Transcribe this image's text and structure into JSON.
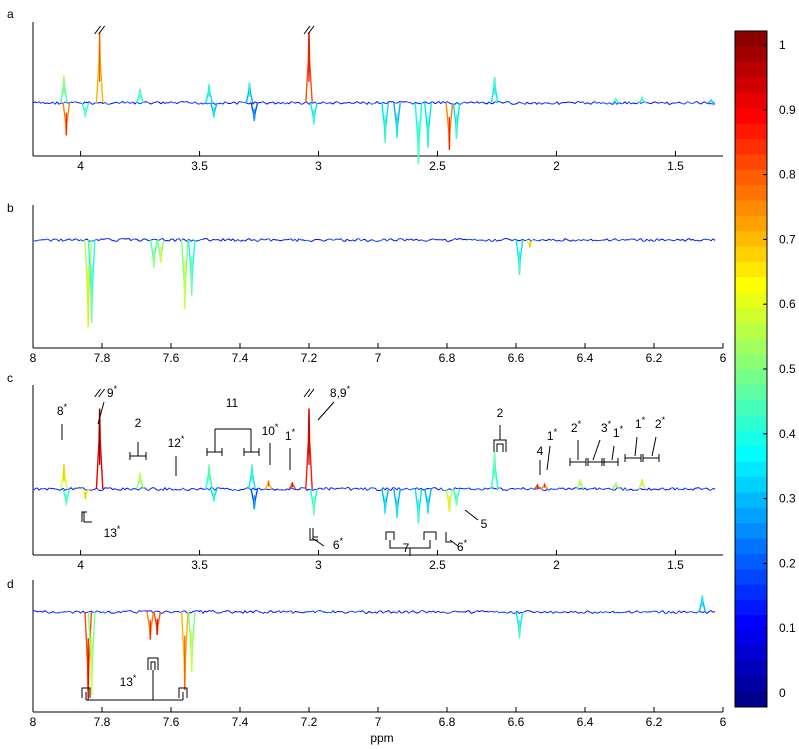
{
  "chart_data": [
    {
      "panel": "a",
      "type": "line",
      "x_axis_reversed": true,
      "xlim": [
        4.2,
        1.3
      ],
      "xticks": [
        "4",
        "3.5",
        "3",
        "2.5",
        "2",
        "1.5"
      ],
      "xtick_values": [
        4,
        3.5,
        3,
        2.5,
        2,
        1.5
      ],
      "ylim": [
        -1,
        1
      ],
      "peaks": [
        {
          "x": 4.07,
          "y": 0.38,
          "c": 0.45
        },
        {
          "x": 4.06,
          "y": -0.45,
          "c": 0.75
        },
        {
          "x": 3.98,
          "y": -0.2,
          "c": 0.4
        },
        {
          "x": 3.92,
          "y": 0.98,
          "c": 0.7
        },
        {
          "x": 3.75,
          "y": 0.2,
          "c": 0.4
        },
        {
          "x": 3.46,
          "y": 0.26,
          "c": 0.35
        },
        {
          "x": 3.44,
          "y": -0.2,
          "c": 0.3
        },
        {
          "x": 3.29,
          "y": 0.28,
          "c": 0.3
        },
        {
          "x": 3.27,
          "y": -0.25,
          "c": 0.2
        },
        {
          "x": 3.04,
          "y": 0.98,
          "c": 0.8
        },
        {
          "x": 3.02,
          "y": -0.3,
          "c": 0.35
        },
        {
          "x": 2.72,
          "y": -0.55,
          "c": 0.35
        },
        {
          "x": 2.67,
          "y": -0.48,
          "c": 0.3
        },
        {
          "x": 2.58,
          "y": -0.85,
          "c": 0.38
        },
        {
          "x": 2.54,
          "y": -0.62,
          "c": 0.35
        },
        {
          "x": 2.45,
          "y": -0.65,
          "c": 0.75
        },
        {
          "x": 2.42,
          "y": -0.5,
          "c": 0.35
        },
        {
          "x": 2.26,
          "y": 0.36,
          "c": 0.35
        },
        {
          "x": 1.75,
          "y": 0.06,
          "c": 0.4
        },
        {
          "x": 1.64,
          "y": 0.08,
          "c": 0.4
        },
        {
          "x": 1.35,
          "y": 0.04,
          "c": 0.3
        }
      ],
      "break_marks": [
        3.92,
        3.04
      ]
    },
    {
      "panel": "b",
      "type": "line",
      "x_axis_reversed": true,
      "xlim": [
        8,
        6
      ],
      "xticks": [
        "8",
        "7.8",
        "7.6",
        "7.4",
        "7.2",
        "7",
        "6.8",
        "6.6",
        "6.4",
        "6.2",
        "6"
      ],
      "xtick_values": [
        8,
        7.8,
        7.6,
        7.4,
        7.2,
        7,
        6.8,
        6.6,
        6.4,
        6.2,
        6
      ],
      "ylim": [
        -1,
        1
      ],
      "peaks": [
        {
          "x": 7.84,
          "y": -0.95,
          "c": 0.55
        },
        {
          "x": 7.83,
          "y": -0.9,
          "c": 0.4
        },
        {
          "x": 7.65,
          "y": -0.3,
          "c": 0.45
        },
        {
          "x": 7.63,
          "y": -0.25,
          "c": 0.5
        },
        {
          "x": 7.56,
          "y": -0.75,
          "c": 0.5
        },
        {
          "x": 7.54,
          "y": -0.6,
          "c": 0.4
        },
        {
          "x": 6.59,
          "y": -0.38,
          "c": 0.35
        },
        {
          "x": 6.56,
          "y": -0.08,
          "c": 0.6
        }
      ],
      "break_marks": []
    },
    {
      "panel": "c",
      "type": "line",
      "x_axis_reversed": true,
      "xlim": [
        4.2,
        1.3
      ],
      "xticks": [
        "4",
        "3.5",
        "3",
        "2.5",
        "2",
        "1.5"
      ],
      "xtick_values": [
        4,
        3.5,
        3,
        2.5,
        2,
        1.5
      ],
      "ylim": [
        -1,
        1
      ],
      "peaks": [
        {
          "x": 4.07,
          "y": 0.3,
          "c": 0.6
        },
        {
          "x": 4.06,
          "y": -0.2,
          "c": 0.4
        },
        {
          "x": 3.98,
          "y": -0.12,
          "c": 0.6
        },
        {
          "x": 3.92,
          "y": 0.98,
          "c": 0.9
        },
        {
          "x": 3.75,
          "y": 0.2,
          "c": 0.5
        },
        {
          "x": 3.46,
          "y": 0.3,
          "c": 0.4
        },
        {
          "x": 3.44,
          "y": -0.15,
          "c": 0.35
        },
        {
          "x": 3.28,
          "y": 0.3,
          "c": 0.35
        },
        {
          "x": 3.27,
          "y": -0.25,
          "c": 0.2
        },
        {
          "x": 3.21,
          "y": 0.1,
          "c": 0.7
        },
        {
          "x": 3.11,
          "y": 0.08,
          "c": 0.8
        },
        {
          "x": 3.04,
          "y": 0.98,
          "c": 0.85
        },
        {
          "x": 3.02,
          "y": -0.32,
          "c": 0.4
        },
        {
          "x": 2.72,
          "y": -0.3,
          "c": 0.3
        },
        {
          "x": 2.67,
          "y": -0.35,
          "c": 0.3
        },
        {
          "x": 2.58,
          "y": -0.42,
          "c": 0.35
        },
        {
          "x": 2.54,
          "y": -0.3,
          "c": 0.3
        },
        {
          "x": 2.45,
          "y": -0.28,
          "c": 0.55
        },
        {
          "x": 2.42,
          "y": -0.2,
          "c": 0.4
        },
        {
          "x": 2.26,
          "y": 0.45,
          "c": 0.4
        },
        {
          "x": 2.08,
          "y": 0.05,
          "c": 0.8
        },
        {
          "x": 2.05,
          "y": 0.06,
          "c": 0.75
        },
        {
          "x": 1.9,
          "y": 0.12,
          "c": 0.5
        },
        {
          "x": 1.75,
          "y": 0.08,
          "c": 0.5
        },
        {
          "x": 1.64,
          "y": 0.12,
          "c": 0.55
        }
      ],
      "break_marks": [
        3.92,
        3.04
      ]
    },
    {
      "panel": "d",
      "type": "line",
      "x_axis_reversed": true,
      "xlim": [
        8,
        6
      ],
      "xticks": [
        "8",
        "7.8",
        "7.6",
        "7.4",
        "7.2",
        "7",
        "6.8",
        "6.6",
        "6.4",
        "6.2",
        "6"
      ],
      "xtick_values": [
        8,
        7.8,
        7.6,
        7.4,
        7.2,
        7,
        6.8,
        6.6,
        6.4,
        6.2,
        6
      ],
      "ylim": [
        -1,
        1
      ],
      "peaks": [
        {
          "x": 7.84,
          "y": -0.95,
          "c": 0.8
        },
        {
          "x": 7.83,
          "y": -0.9,
          "c": 0.5
        },
        {
          "x": 7.66,
          "y": -0.3,
          "c": 0.75
        },
        {
          "x": 7.64,
          "y": -0.25,
          "c": 0.8
        },
        {
          "x": 7.56,
          "y": -0.85,
          "c": 0.7
        },
        {
          "x": 7.54,
          "y": -0.65,
          "c": 0.5
        },
        {
          "x": 6.59,
          "y": -0.28,
          "c": 0.35
        },
        {
          "x": 6.06,
          "y": 0.18,
          "c": 0.3
        }
      ],
      "break_marks": []
    }
  ],
  "panels": [
    {
      "letter": "a"
    },
    {
      "letter": "b"
    },
    {
      "letter": "c"
    },
    {
      "letter": "d"
    }
  ],
  "xlabel": "ppm",
  "colorbar": {
    "ticks": [
      "0",
      "0.1",
      "0.2",
      "0.3",
      "0.4",
      "0.5",
      "0.6",
      "0.7",
      "0.8",
      "0.9",
      "1"
    ],
    "colormap": "jet"
  },
  "annotations_c": [
    {
      "label": "8",
      "sup": "*",
      "x": 4.08
    },
    {
      "label": "9",
      "sup": "*",
      "x": 3.88
    },
    {
      "label": "2",
      "sup": "",
      "x": 3.75
    },
    {
      "label": "12",
      "sup": "*",
      "x": 3.6
    },
    {
      "label": "11",
      "sup": "",
      "x": 3.36
    },
    {
      "label": "10",
      "sup": "*",
      "x": 3.22
    },
    {
      "label": "1",
      "sup": "*",
      "x": 3.11
    },
    {
      "label": "8,9",
      "sup": "*",
      "x": 2.95
    },
    {
      "label": "2",
      "sup": "",
      "x": 2.26
    },
    {
      "label": "4",
      "sup": "",
      "x": 2.08
    },
    {
      "label": "1",
      "sup": "*",
      "x": 2.05
    },
    {
      "label": "2",
      "sup": "*",
      "x": 1.92
    },
    {
      "label": "3",
      "sup": "*",
      "x": 1.81
    },
    {
      "label": "1",
      "sup": "*",
      "x": 1.76
    },
    {
      "label": "1",
      "sup": "*",
      "x": 1.66
    },
    {
      "label": "2",
      "sup": "*",
      "x": 1.61
    },
    {
      "label": "13",
      "sup": "*",
      "x": 3.92
    },
    {
      "label": "6",
      "sup": "*",
      "x": 3.0
    },
    {
      "label": "7",
      "sup": "",
      "x": 2.62
    },
    {
      "label": "6",
      "sup": "*",
      "x": 2.4
    },
    {
      "label": "5",
      "sup": "",
      "x": 2.38
    }
  ],
  "annotations_d": [
    {
      "label": "13",
      "sup": "*",
      "x": 7.7
    }
  ]
}
